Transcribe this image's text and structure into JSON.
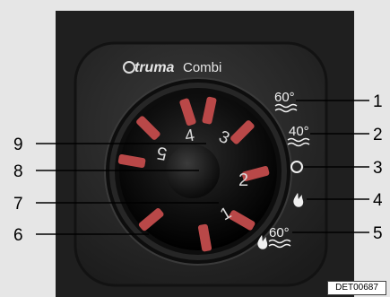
{
  "brand": {
    "logo_text": "truma",
    "model": "Combi"
  },
  "scale": {
    "d1": "1",
    "d2": "2",
    "d3": "3",
    "d4": "4",
    "d5": "5"
  },
  "right_symbols": {
    "hot_60": "60°",
    "hot_40": "40°",
    "gas_60": "60°"
  },
  "callouts": [
    "1",
    "2",
    "3",
    "4",
    "5",
    "6",
    "7",
    "8",
    "9"
  ],
  "document_id": "DET00687",
  "colors": {
    "housing": "#2b2b2b",
    "knob": "#151515",
    "indicator": "#c64a4a",
    "label_bg": "#ffffff"
  }
}
